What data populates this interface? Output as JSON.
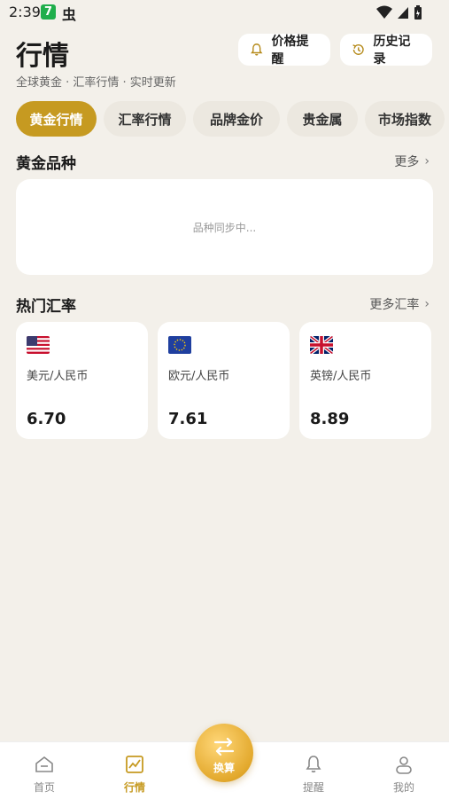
{
  "status_bar": {
    "time": "2:39",
    "app_badge": "7",
    "bug_glyph": "虫"
  },
  "header": {
    "title": "行情",
    "subtitle": "全球黄金 · 汇率行情 · 实时更新",
    "alert_button": "价格提醒",
    "history_button": "历史记录"
  },
  "tabs": [
    {
      "label": "黄金行情",
      "active": true
    },
    {
      "label": "汇率行情",
      "active": false
    },
    {
      "label": "品牌金价",
      "active": false
    },
    {
      "label": "贵金属",
      "active": false
    },
    {
      "label": "市场指数",
      "active": false
    }
  ],
  "gold_section": {
    "title": "黄金品种",
    "more": "更多",
    "placeholder": "品种同步中..."
  },
  "rates_section": {
    "title": "热门汇率",
    "more": "更多汇率",
    "cards": [
      {
        "pair": "美元/人民币",
        "value": "6.70",
        "flag_icon": "us-flag-icon"
      },
      {
        "pair": "欧元/人民币",
        "value": "7.61",
        "flag_icon": "eu-flag-icon"
      },
      {
        "pair": "英镑/人民币",
        "value": "8.89",
        "flag_icon": "uk-flag-icon"
      }
    ]
  },
  "bottom_nav": {
    "items": [
      {
        "label": "首页",
        "icon": "home-icon",
        "active": false
      },
      {
        "label": "行情",
        "icon": "chart-icon",
        "active": true
      },
      {
        "label": "提醒",
        "icon": "bell-icon",
        "active": false
      },
      {
        "label": "我的",
        "icon": "user-icon",
        "active": false
      }
    ],
    "fab_label": "换算"
  },
  "colors": {
    "accent": "#c69a21",
    "background": "#f3f0ea",
    "card": "#ffffff"
  }
}
